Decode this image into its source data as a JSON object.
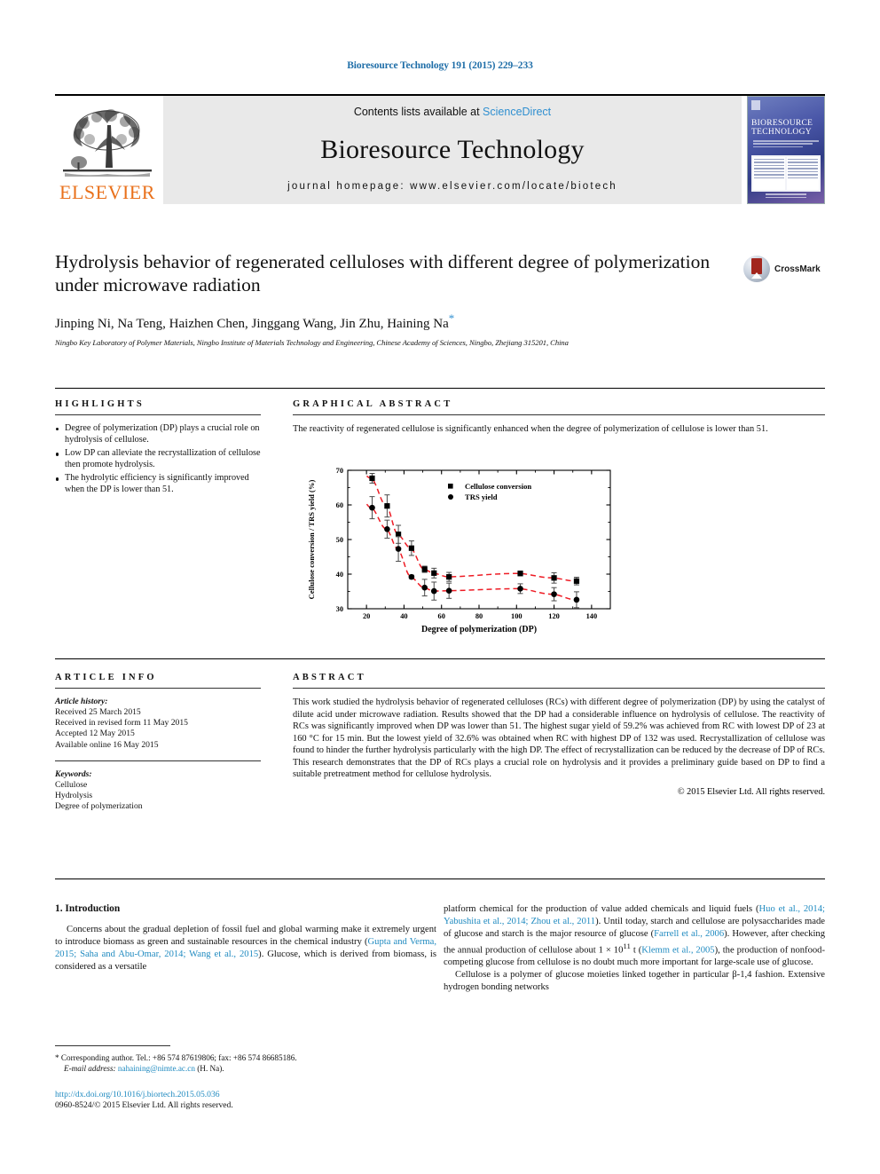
{
  "running_head": "Bioresource Technology 191 (2015) 229–233",
  "masthead": {
    "publisher": "ELSEVIER",
    "contents_prefix": "Contents lists available at ",
    "contents_link": "ScienceDirect",
    "journal_name": "Bioresource Technology",
    "homepage": "journal homepage: www.elsevier.com/locate/biotech",
    "cover_title_line1": "BIORESOURCE",
    "cover_title_line2": "TECHNOLOGY"
  },
  "article": {
    "title": "Hydrolysis behavior of regenerated celluloses with different degree of polymerization under microwave radiation",
    "authors": "Jinping Ni, Na Teng, Haizhen Chen, Jinggang Wang, Jin Zhu, Haining Na",
    "corresponding_mark": "*",
    "affiliation": "Ningbo Key Laboratory of Polymer Materials, Ningbo Institute of Materials Technology and Engineering, Chinese Academy of Sciences, Ningbo, Zhejiang 315201, China",
    "crossmark_label": "CrossMark"
  },
  "highlights": {
    "heading": "HIGHLIGHTS",
    "items": [
      "Degree of polymerization (DP) plays a crucial role on hydrolysis of cellulose.",
      "Low DP can alleviate the recrystallization of cellulose then promote hydrolysis.",
      "The hydrolytic efficiency is significantly improved when the DP is lower than 51."
    ]
  },
  "graphical_abstract": {
    "heading": "GRAPHICAL ABSTRACT",
    "caption": "The reactivity of regenerated cellulose is significantly enhanced when the degree of polymerization of cellulose is lower than 51."
  },
  "chart_data": {
    "type": "scatter",
    "title": "",
    "xlabel": "Degree of polymerization (DP)",
    "ylabel": "Cellulose conversion / TRS yield (%)",
    "xlim": [
      10,
      150
    ],
    "ylim": [
      30,
      70
    ],
    "xticks": [
      20,
      40,
      60,
      80,
      100,
      120,
      140
    ],
    "yticks": [
      30,
      40,
      50,
      60,
      70
    ],
    "grid": false,
    "legend_position": "top-right",
    "trendline_color": "#ee1c25",
    "trendline_style": "dashed",
    "series": [
      {
        "name": "Cellulose conversion",
        "marker": "square",
        "color": "#000000",
        "points": [
          {
            "x": 23,
            "y": 67.7,
            "err": 1.4
          },
          {
            "x": 31,
            "y": 59.7,
            "err": 3.2
          },
          {
            "x": 37,
            "y": 51.5,
            "err": 2.6
          },
          {
            "x": 44,
            "y": 47.5,
            "err": 2.1
          },
          {
            "x": 51,
            "y": 41.4,
            "err": 0.9
          },
          {
            "x": 56,
            "y": 40.3,
            "err": 1.4
          },
          {
            "x": 64,
            "y": 39.2,
            "err": 1.3
          },
          {
            "x": 102,
            "y": 40.2,
            "err": 0.7
          },
          {
            "x": 120,
            "y": 38.9,
            "err": 1.5
          },
          {
            "x": 132,
            "y": 38.0,
            "err": 1.1
          }
        ]
      },
      {
        "name": "TRS yield",
        "marker": "circle",
        "color": "#000000",
        "points": [
          {
            "x": 23,
            "y": 59.2,
            "err": 3.2
          },
          {
            "x": 31,
            "y": 53.0,
            "err": 2.6
          },
          {
            "x": 37,
            "y": 47.3,
            "err": 3.6
          },
          {
            "x": 44,
            "y": 39.2,
            "err": 0.5
          },
          {
            "x": 51,
            "y": 36.1,
            "err": 2.4
          },
          {
            "x": 56,
            "y": 35.1,
            "err": 2.6
          },
          {
            "x": 64,
            "y": 35.2,
            "err": 2.2
          },
          {
            "x": 102,
            "y": 35.8,
            "err": 1.4
          },
          {
            "x": 120,
            "y": 34.2,
            "err": 1.9
          },
          {
            "x": 132,
            "y": 32.6,
            "err": 2.3
          }
        ]
      }
    ]
  },
  "article_info": {
    "heading": "ARTICLE INFO",
    "history_label": "Article history:",
    "history": [
      "Received 25 March 2015",
      "Received in revised form 11 May 2015",
      "Accepted 12 May 2015",
      "Available online 16 May 2015"
    ],
    "keywords_label": "Keywords:",
    "keywords": [
      "Cellulose",
      "Hydrolysis",
      "Degree of polymerization"
    ]
  },
  "abstract": {
    "heading": "ABSTRACT",
    "body": "This work studied the hydrolysis behavior of regenerated celluloses (RCs) with different degree of polymerization (DP) by using the catalyst of dilute acid under microwave radiation. Results showed that the DP had a considerable influence on hydrolysis of cellulose. The reactivity of RCs was significantly improved when DP was lower than 51. The highest sugar yield of 59.2% was achieved from RC with lowest DP of 23 at 160 °C for 15 min. But the lowest yield of 32.6% was obtained when RC with highest DP of 132 was used. Recrystallization of cellulose was found to hinder the further hydrolysis particularly with the high DP. The effect of recrystallization can be reduced by the decrease of DP of RCs. This research demonstrates that the DP of RCs plays a crucial role on hydrolysis and it provides a preliminary guide based on DP to find a suitable pretreatment method for cellulose hydrolysis.",
    "copyright": "© 2015 Elsevier Ltd. All rights reserved."
  },
  "introduction": {
    "heading": "1. Introduction",
    "left_para_1_a": "Concerns about the gradual depletion of fossil fuel and global warming make it extremely urgent to introduce biomass as green and sustainable resources in the chemical industry (",
    "left_para_1_cite": "Gupta and Verma, 2015; Saha and Abu-Omar, 2014; Wang et al., 2015",
    "left_para_1_b": "). Glucose, which is derived from biomass, is considered as a versatile",
    "right_para_1_a": "platform chemical for the production of value added chemicals and liquid fuels (",
    "right_cite_1": "Huo et al., 2014; Yabushita et al., 2014; Zhou et al., 2011",
    "right_para_1_b": "). Until today, starch and cellulose are polysaccharides made of glucose and starch is the major resource of glucose (",
    "right_cite_2": "Farrell et al., 2006",
    "right_para_1_c": "). However, after checking the annual production of cellulose about 1 × 10",
    "right_exp": "11",
    "right_para_1_d": " t (",
    "right_cite_3": "Klemm et al., 2005",
    "right_para_1_e": "), the production of nonfood-competing glucose from cellulose is no doubt much more important for large-scale use of glucose.",
    "right_para_2": "Cellulose is a polymer of glucose moieties linked together in particular β-1,4 fashion. Extensive hydrogen bonding networks"
  },
  "footnote": {
    "corresponding_mark": "*",
    "corresponding": "Corresponding author. Tel.: +86 574 87619806; fax: +86 574 86685186.",
    "email_label": "E-mail address:",
    "email": "nahaining@nimte.ac.cn",
    "email_suffix": "(H. Na).",
    "doi": "http://dx.doi.org/10.1016/j.biortech.2015.05.036",
    "issn": "0960-8524/© 2015 Elsevier Ltd. All rights reserved."
  }
}
